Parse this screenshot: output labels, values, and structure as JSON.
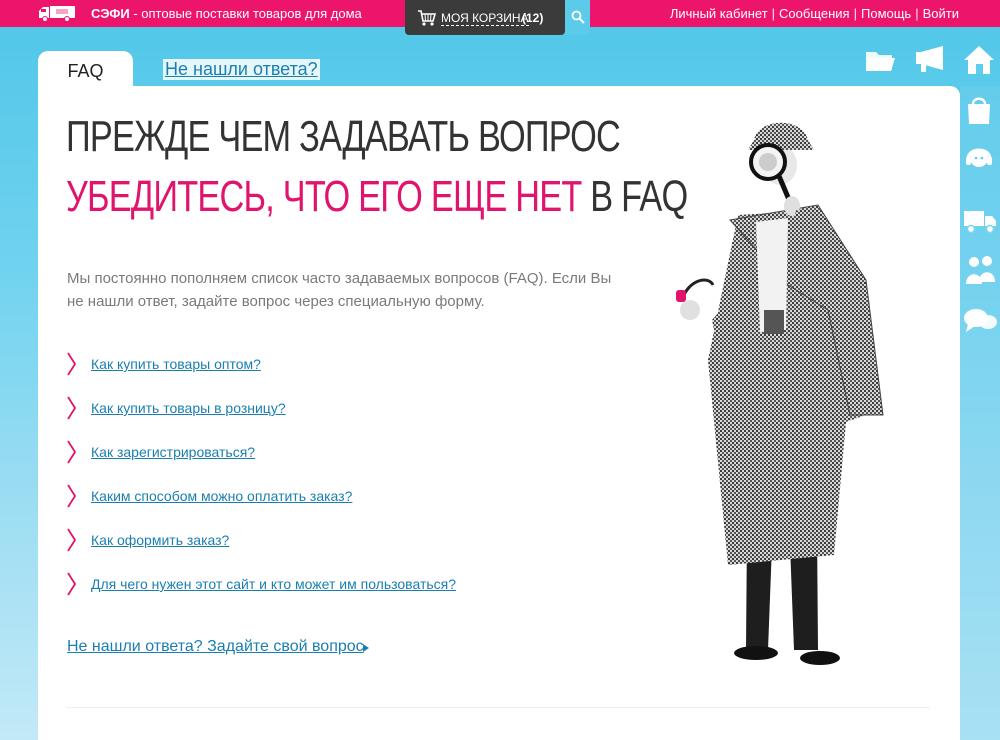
{
  "header": {
    "brand_name": "СЭФИ",
    "brand_tagline": " - оптовые поставки товаров для дома",
    "cart_label": "МОЯ КОРЗИНА",
    "cart_count": "(12)",
    "links": [
      "Личный кабинет",
      "Сообщения",
      "Помощь",
      "Войти"
    ]
  },
  "tabs": {
    "active": "FAQ",
    "secondary": "Не нашли ответа?"
  },
  "main": {
    "heading_line1": "ПРЕЖДЕ ЧЕМ ЗАДАВАТЬ ВОПРОС",
    "heading_line2_accent": "УБЕДИТЕСЬ, ЧТО ЕГО ЕЩЕ НЕТ",
    "heading_line2_rest": " В FAQ",
    "intro": "Мы постоянно пополняем список часто задаваемых вопросов (FAQ). Если Вы не нашли ответ, задайте вопрос через специальную форму.",
    "questions": [
      "Как купить товары оптом?",
      "Как купить товары в розницу?",
      "Как зарегистрироваться?",
      "Каким способом можно оплатить заказ?",
      "Как оформить заказ?",
      "Для чего нужен этот сайт и кто может им пользоваться?"
    ],
    "ask_link": "Не нашли ответа? Задайте свой вопрос"
  },
  "sidebar_icons": [
    "folder-icon",
    "megaphone-icon",
    "home-icon",
    "shopping-bag-icon",
    "support-headset-icon",
    "delivery-truck-icon",
    "people-icon",
    "chat-icon"
  ],
  "colors": {
    "accent_pink": "#ec146b",
    "link_blue": "#1a7fb0",
    "cart_dark": "#3b3b3b"
  }
}
